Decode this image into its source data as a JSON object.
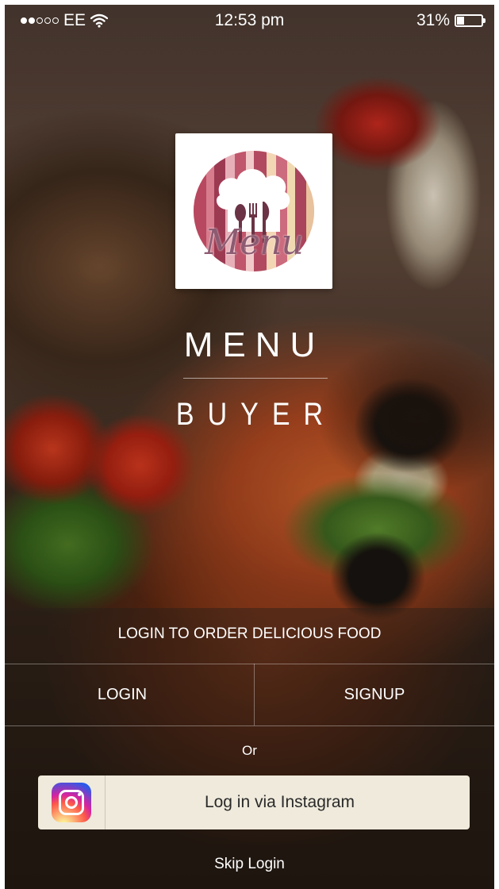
{
  "status_bar": {
    "carrier": "EE",
    "time": "12:53 pm",
    "battery_text": "31%",
    "battery_level": 0.31,
    "signal_bars_total": 5,
    "signal_bars_on": 2,
    "icons": [
      "signal-dots-icon",
      "wifi-icon",
      "battery-icon"
    ]
  },
  "branding": {
    "logo_text": "Menu",
    "title": "MENU",
    "subtitle": "BUYER",
    "logo_icon": "chef-hat-cutlery-icon",
    "logo_colors": [
      "#c05a6e",
      "#e3a1ad",
      "#f4d7b7",
      "#9a3f57"
    ]
  },
  "login_panel": {
    "tagline": "LOGIN TO ORDER DELICIOUS FOOD",
    "login_label": "LOGIN",
    "signup_label": "SIGNUP",
    "or_label": "Or",
    "instagram_label": "Log in via Instagram",
    "instagram_icon": "instagram-icon",
    "skip_label": "Skip Login"
  },
  "colors": {
    "instagram_button_bg": "#efeadb",
    "text_light": "#ffffff"
  }
}
